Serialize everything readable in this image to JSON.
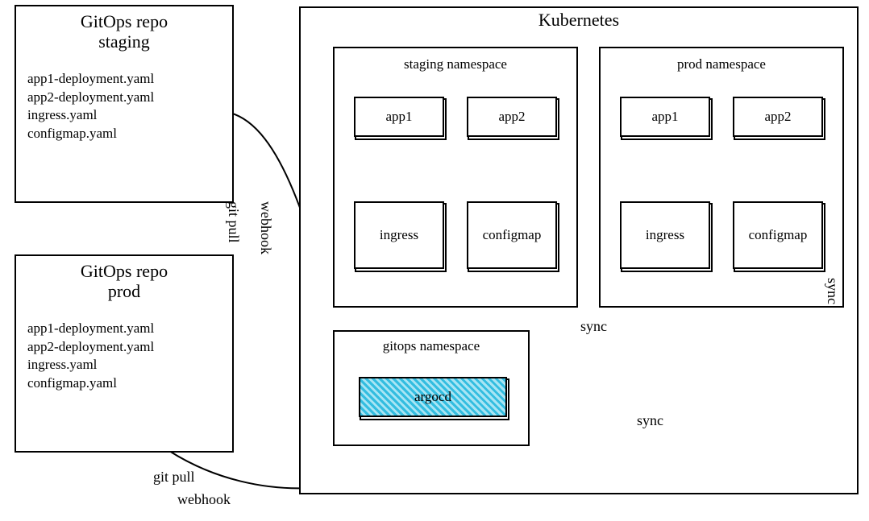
{
  "repos": {
    "staging": {
      "title_l1": "GitOps repo",
      "title_l2": "staging",
      "files": [
        "app1-deployment.yaml",
        "app2-deployment.yaml",
        "ingress.yaml",
        "configmap.yaml"
      ]
    },
    "prod": {
      "title_l1": "GitOps repo",
      "title_l2": "prod",
      "files": [
        "app1-deployment.yaml",
        "app2-deployment.yaml",
        "ingress.yaml",
        "configmap.yaml"
      ]
    }
  },
  "cluster": {
    "title": "Kubernetes",
    "namespaces": {
      "staging": {
        "title": "staging namespace",
        "resources": [
          "app1",
          "app2",
          "ingress",
          "configmap"
        ]
      },
      "prod": {
        "title": "prod namespace",
        "resources": [
          "app1",
          "app2",
          "ingress",
          "configmap"
        ]
      },
      "gitops": {
        "title": "gitops namespace",
        "component": "argocd"
      }
    }
  },
  "labels": {
    "git_pull": "git pull",
    "webhook": "webhook",
    "sync": "sync"
  },
  "arrows": [
    {
      "from": "repo-staging",
      "to": "argocd",
      "label": "git pull / webhook"
    },
    {
      "from": "repo-prod",
      "to": "argocd",
      "label": "git pull / webhook"
    },
    {
      "from": "argocd",
      "to": "staging-namespace",
      "label": "sync"
    },
    {
      "from": "argocd",
      "to": "prod-namespace",
      "label": "sync"
    }
  ]
}
